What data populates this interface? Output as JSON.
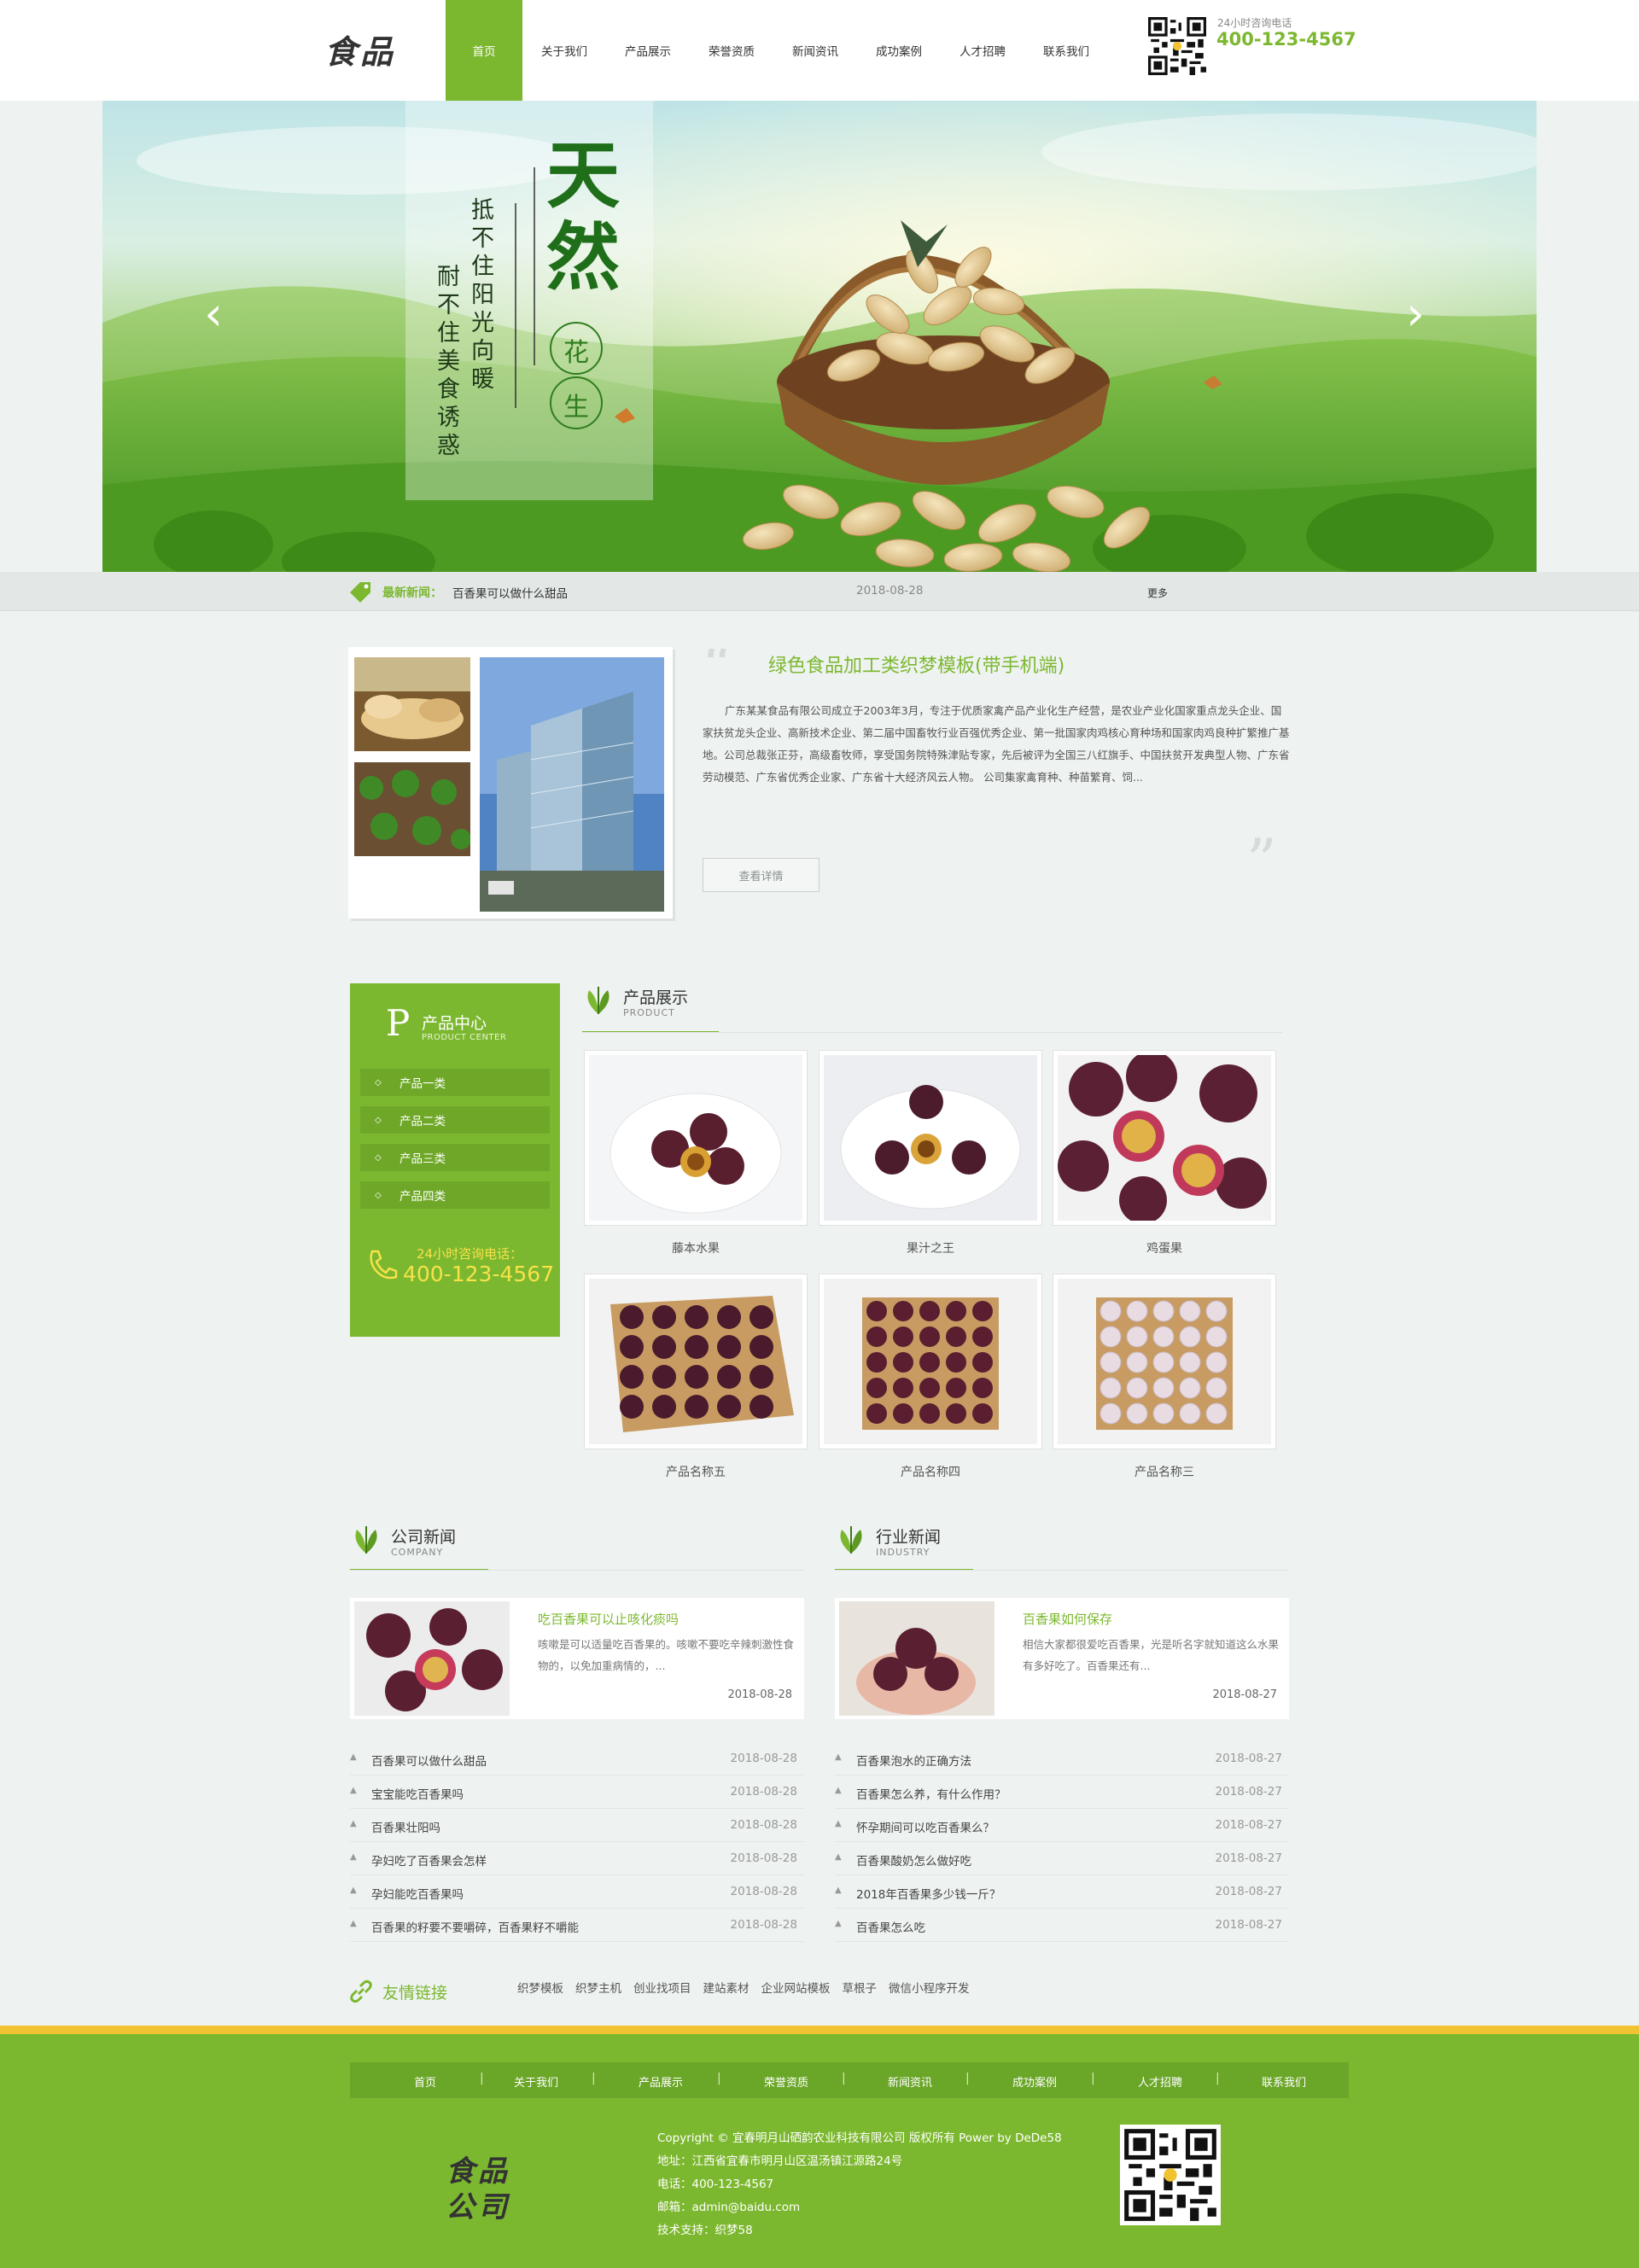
{
  "header": {
    "logo": "食品",
    "nav": [
      "首页",
      "关于我们",
      "产品展示",
      "荣誉资质",
      "新闻资讯",
      "成功案例",
      "人才招聘",
      "联系我们"
    ],
    "hotline_label": "24小时咨询电话",
    "hotline": "400-123-4567"
  },
  "banner": {
    "title": "天然",
    "badge_top": "花",
    "badge_bottom": "生",
    "line1": "抵不住阳光向暖",
    "line2": "耐不住美食诱惑"
  },
  "newsbar": {
    "label": "最新新闻：",
    "title": "百香果可以做什么甜品",
    "date": "2018-08-28",
    "more": "更多"
  },
  "about": {
    "title": "绿色食品加工类织梦模板(带手机端)",
    "text": "广东某某食品有限公司成立于2003年3月，专注于优质家禽产品产业化生产经营，是农业产业化国家重点龙头企业、国家扶贫龙头企业、高新技术企业、第二届中国畜牧行业百强优秀企业、第一批国家肉鸡核心育种场和国家肉鸡良种扩繁推广基地。公司总裁张正芬，高级畜牧师，享受国务院特殊津贴专家，先后被评为全国三八红旗手、中国扶贫开发典型人物、广东省劳动模范、广东省优秀企业家、广东省十大经济风云人物。 公司集家禽育种、种苗繁育、饲...",
    "button": "查看详情"
  },
  "product_center": {
    "title": "产品中心",
    "letter": "P",
    "subtitle": "PRODUCT CENTER",
    "categories": [
      "产品一类",
      "产品二类",
      "产品三类",
      "产品四类"
    ],
    "hotline_label": "24小时咨询电话：",
    "hotline": "400-123-4567"
  },
  "products": {
    "title": "产品展示",
    "subtitle": "PRODUCT",
    "items": [
      {
        "name": "藤本水果"
      },
      {
        "name": "果汁之王"
      },
      {
        "name": "鸡蛋果"
      },
      {
        "name": "产品名称五"
      },
      {
        "name": "产品名称四"
      },
      {
        "name": "产品名称三"
      }
    ]
  },
  "company_news": {
    "title": "公司新闻",
    "subtitle": "COMPANY",
    "featured": {
      "title": "吃百香果可以止咳化痰吗",
      "summary": "咳嗽是可以适量吃百香果的。咳嗽不要吃辛辣刺激性食物的，以免加重病情的，...",
      "date": "2018-08-28"
    },
    "list": [
      {
        "title": "百香果可以做什么甜品",
        "date": "2018-08-28"
      },
      {
        "title": "宝宝能吃百香果吗",
        "date": "2018-08-28"
      },
      {
        "title": "百香果壮阳吗",
        "date": "2018-08-28"
      },
      {
        "title": "孕妇吃了百香果会怎样",
        "date": "2018-08-28"
      },
      {
        "title": "孕妇能吃百香果吗",
        "date": "2018-08-28"
      },
      {
        "title": "百香果的籽要不要嚼碎，百香果籽不嚼能",
        "date": "2018-08-28"
      }
    ]
  },
  "industry_news": {
    "title": "行业新闻",
    "subtitle": "INDUSTRY",
    "featured": {
      "title": "百香果如何保存",
      "summary": "相信大家都很爱吃百香果，光是听名字就知道这么水果有多好吃了。百香果还有...",
      "date": "2018-08-27"
    },
    "list": [
      {
        "title": "百香果泡水的正确方法",
        "date": "2018-08-27"
      },
      {
        "title": "百香果怎么养，有什么作用？",
        "date": "2018-08-27"
      },
      {
        "title": "怀孕期间可以吃百香果么？",
        "date": "2018-08-27"
      },
      {
        "title": "百香果酸奶怎么做好吃",
        "date": "2018-08-27"
      },
      {
        "title": "2018年百香果多少钱一斤？",
        "date": "2018-08-27"
      },
      {
        "title": "百香果怎么吃",
        "date": "2018-08-27"
      }
    ]
  },
  "friend_links": {
    "title": "友情链接",
    "links": [
      "织梦模板",
      "织梦主机",
      "创业找项目",
      "建站素材",
      "企业网站模板",
      "草根子",
      "微信小程序开发"
    ]
  },
  "footer": {
    "nav": [
      "首页",
      "关于我们",
      "产品展示",
      "荣誉资质",
      "新闻资讯",
      "成功案例",
      "人才招聘",
      "联系我们"
    ],
    "logo_line1": "食品",
    "logo_line2": "公司",
    "copyright": "Copyright © 宜春明月山硒韵农业科技有限公司 版权所有 Power by DeDe58",
    "address": "地址：江西省宜春市明月山区温汤镇江源路24号",
    "phone": "电话：400-123-4567",
    "email": "邮箱：admin@baidu.com",
    "support": "技术支持：织梦58"
  },
  "colors": {
    "accent": "#7cb82f",
    "footer_strip": "#f1c232"
  }
}
